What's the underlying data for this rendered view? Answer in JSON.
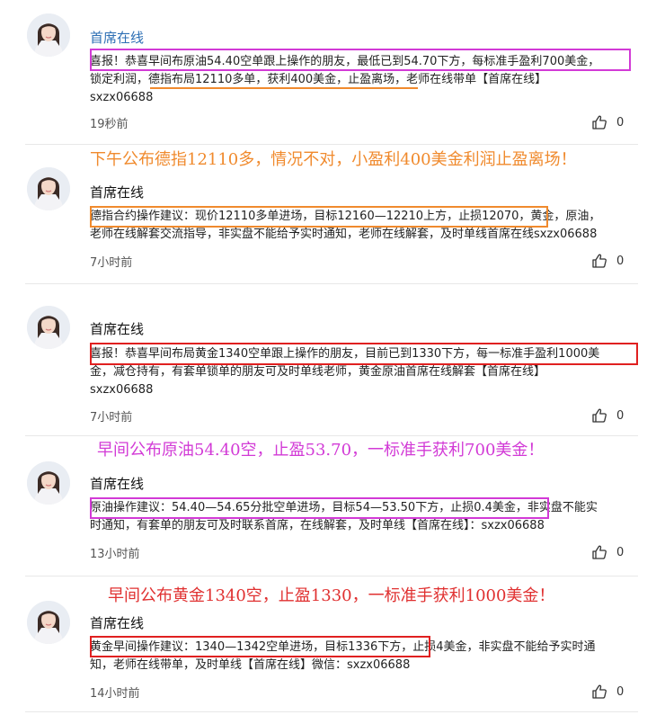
{
  "posts": [
    {
      "author": "首席在线",
      "lines": [
        "喜报！恭喜早间布原油54.40空单跟上操作的朋友，最低已到54.70下方，每标准手盈利700美金，",
        "锁定利润，德指布局12110多单，获利400美金，止盈离场，老师在线带单【首席在线】",
        "sxzx06688"
      ],
      "time": "19秒前",
      "likes": "0"
    },
    {
      "banner": "下午公布德指12110多，情况不对，小盈利400美金利润止盈离场！",
      "author": "首席在线",
      "lines": [
        "德指合约操作建议：现价12110多单进场，目标12160—12210上方，止损12070，黄金，原油，",
        "老师在线解套交流指导，非实盘不能给予实时通知，老师在线解套，及时单线首席在线sxzx06688"
      ],
      "time": "7小时前",
      "likes": "0"
    },
    {
      "author": "首席在线",
      "lines": [
        "喜报！恭喜早间布局黄金1340空单跟上操作的朋友，目前已到1330下方，每一标准手盈利1000美",
        "金，减仓持有，有套单锁单的朋友可及时单线老师，黄金原油首席在线解套【首席在线】",
        "sxzx06688"
      ],
      "time": "7小时前",
      "likes": "0"
    },
    {
      "banner": "早间公布原油54.40空，止盈53.70，一标准手获利700美金！",
      "author": "首席在线",
      "lines": [
        "原油操作建议：54.40—54.65分批空单进场，目标54—53.50下方，止损0.4美金，非实盘不能实",
        "时通知，有套单的朋友可及时联系首席，在线解套，及时单线【首席在线】：sxzx06688"
      ],
      "time": "13小时前",
      "likes": "0"
    },
    {
      "banner": "早间公布黄金1340空，止盈1330，一标准手获利1000美金！",
      "author": "首席在线",
      "lines": [
        "黄金早间操作建议：1340—1342空单进场，目标1336下方，止损4美金，非实盘不能给予实时通",
        "知，老师在线带单，及时单线【首席在线】微信：sxzx06688"
      ],
      "time": "14小时前",
      "likes": "0"
    }
  ],
  "colors": {
    "author_link": "#2d6fb4",
    "highlight_magenta": "#d23ad6",
    "highlight_orange": "#f08a2d",
    "highlight_red": "#e02020",
    "banner_orange": "#f08a2d",
    "banner_magenta": "#d23ad6",
    "banner_red": "#e03030"
  },
  "icons": {
    "avatar": "avatar-portrait",
    "like": "thumbs-up-icon"
  }
}
